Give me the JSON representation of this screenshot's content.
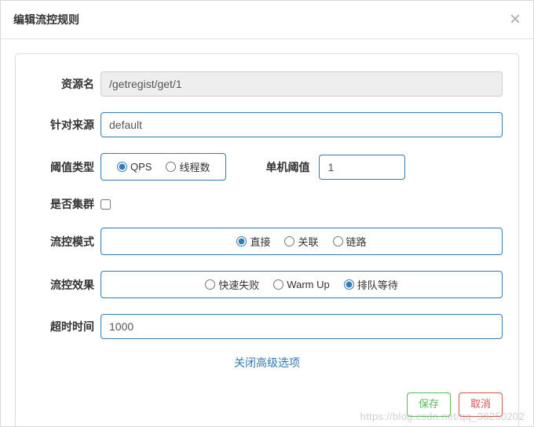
{
  "modal": {
    "title": "编辑流控规则",
    "close": "×"
  },
  "form": {
    "resource": {
      "label": "资源名",
      "value": "/getregist/get/1"
    },
    "source": {
      "label": "针对来源",
      "value": "default"
    },
    "thresholdType": {
      "label": "阈值类型",
      "options": {
        "qps": "QPS",
        "thread": "线程数"
      }
    },
    "singleThreshold": {
      "label": "单机阈值",
      "value": "1"
    },
    "cluster": {
      "label": "是否集群"
    },
    "mode": {
      "label": "流控模式",
      "options": {
        "direct": "直接",
        "relate": "关联",
        "chain": "链路"
      }
    },
    "effect": {
      "label": "流控效果",
      "options": {
        "fail": "快速失败",
        "warmup": "Warm Up",
        "queue": "排队等待"
      }
    },
    "timeout": {
      "label": "超时时间",
      "value": "1000"
    },
    "advToggle": "关闭高级选项"
  },
  "actions": {
    "save": "保存",
    "cancel": "取消"
  },
  "watermark": "https://blog.csdn.net/qq_36250202"
}
